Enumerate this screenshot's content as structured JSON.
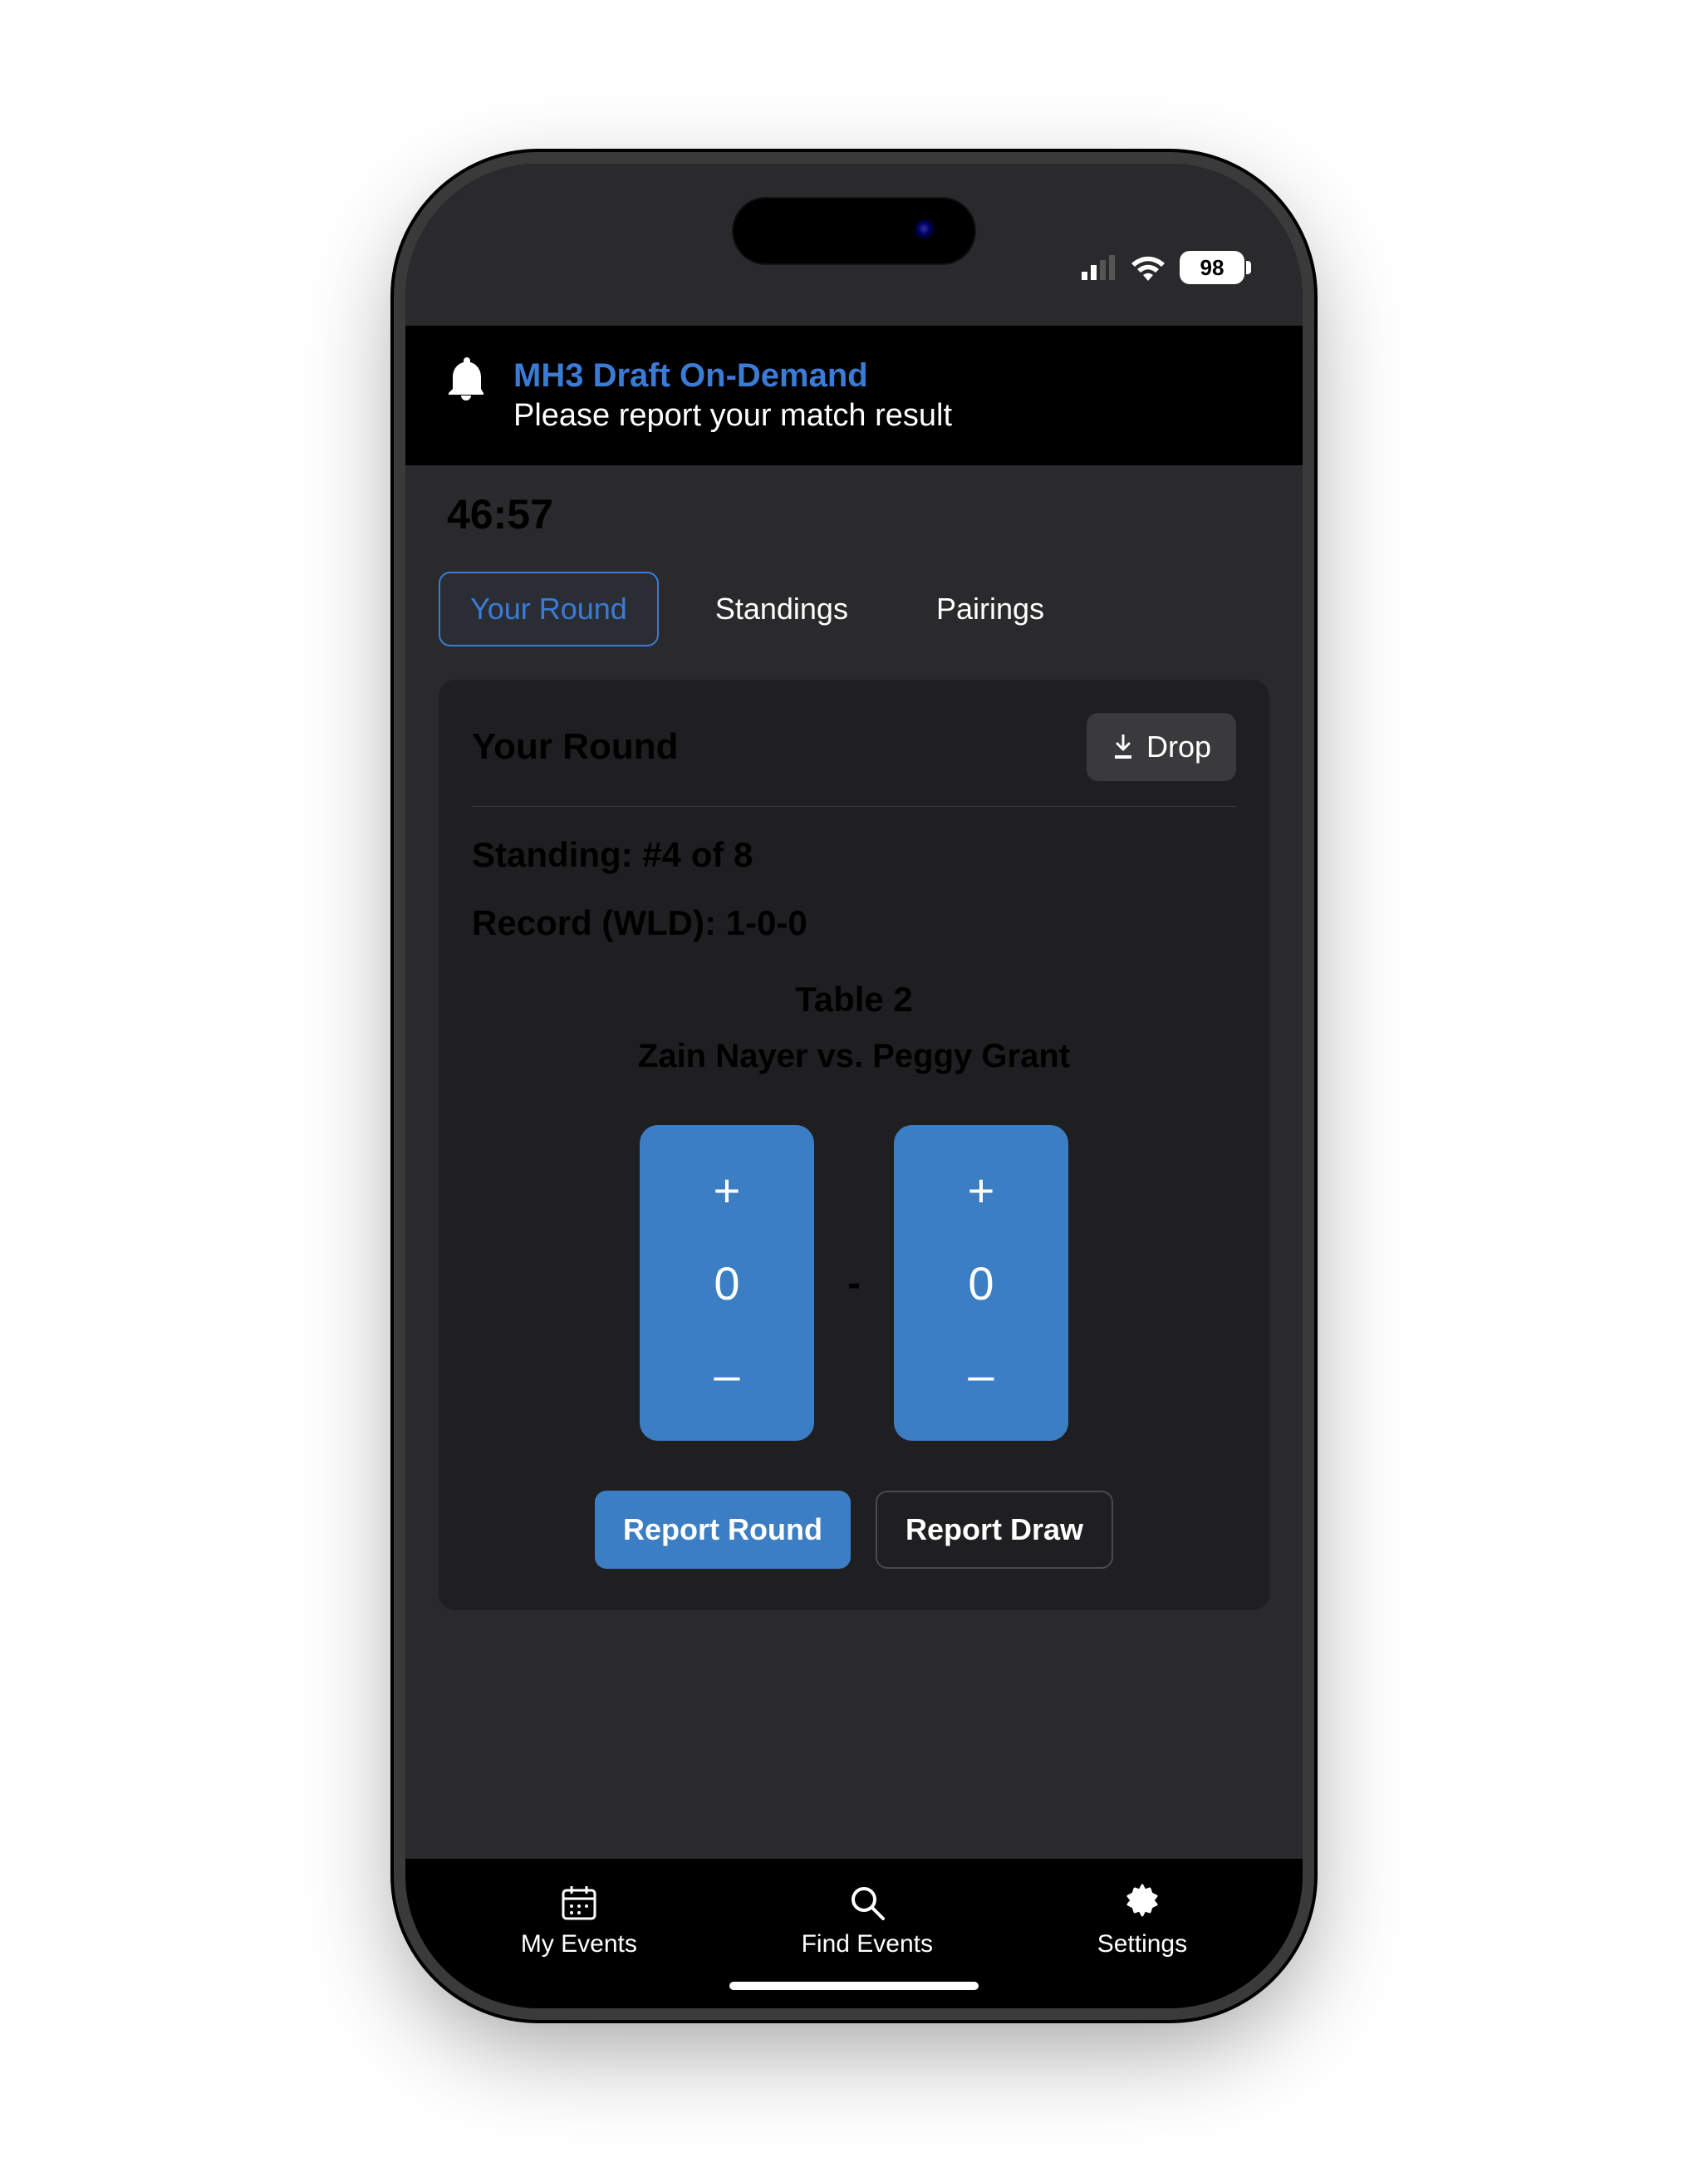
{
  "status": {
    "battery": "98"
  },
  "banner": {
    "title": "MH3 Draft On-Demand",
    "message": "Please report your match result"
  },
  "timer": "46:57",
  "tabs": {
    "your_round": "Your Round",
    "standings": "Standings",
    "pairings": "Pairings"
  },
  "card": {
    "title": "Your Round",
    "drop_label": "Drop",
    "standing_line": "Standing: #4 of 8",
    "record_line": "Record (WLD): 1-0-0",
    "table_label": "Table 2",
    "matchup": "Zain Nayer vs. Peggy Grant",
    "score_left": "0",
    "score_right": "0",
    "separator": "-",
    "report_round": "Report Round",
    "report_draw": "Report Draw"
  },
  "nav": {
    "my_events": "My Events",
    "find_events": "Find Events",
    "settings": "Settings"
  }
}
